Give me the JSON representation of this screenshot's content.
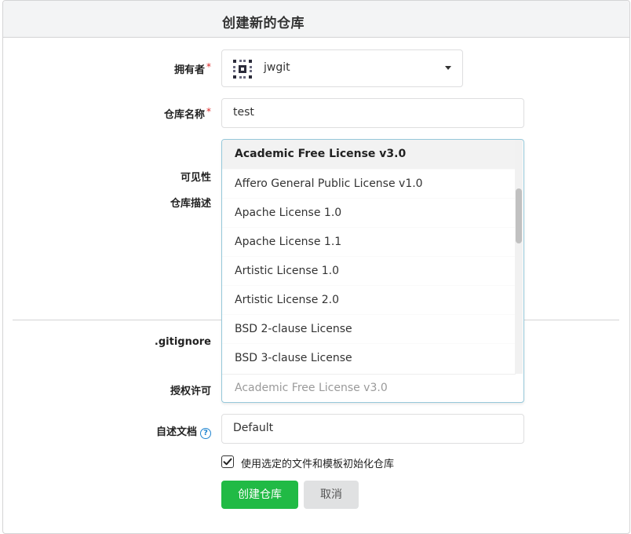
{
  "header": {
    "title": "创建新的仓库"
  },
  "owner": {
    "label": "拥有者",
    "required_mark": "*",
    "value": "jwgit",
    "avatar_icon": "identicon-avatar"
  },
  "repo_name": {
    "label": "仓库名称",
    "required_mark": "*",
    "value": "test"
  },
  "visibility": {
    "label": "可见性"
  },
  "description": {
    "label": "仓库描述"
  },
  "gitignore": {
    "label": ".gitignore"
  },
  "license": {
    "label": "授权许可",
    "options": [
      "Academic Free License v3.0",
      "Affero General Public License v1.0",
      "Apache License 1.0",
      "Apache License 1.1",
      "Artistic License 1.0",
      "Artistic License 2.0",
      "BSD 2-clause License",
      "BSD 3-clause License"
    ],
    "highlighted_option": "Academic Free License v3.0",
    "selected_text": "Academic Free License v3.0"
  },
  "readme": {
    "label": "自述文档",
    "help_icon": "question-circle-icon",
    "value": "Default"
  },
  "auto_init": {
    "checked": true,
    "label": "使用选定的文件和模板初始化仓库"
  },
  "buttons": {
    "create": "创建仓库",
    "cancel": "取消"
  },
  "colors": {
    "primary_button": "#21ba45",
    "required": "#db2828",
    "dropdown_border": "#96c8da",
    "help_icon": "#2185d0"
  }
}
